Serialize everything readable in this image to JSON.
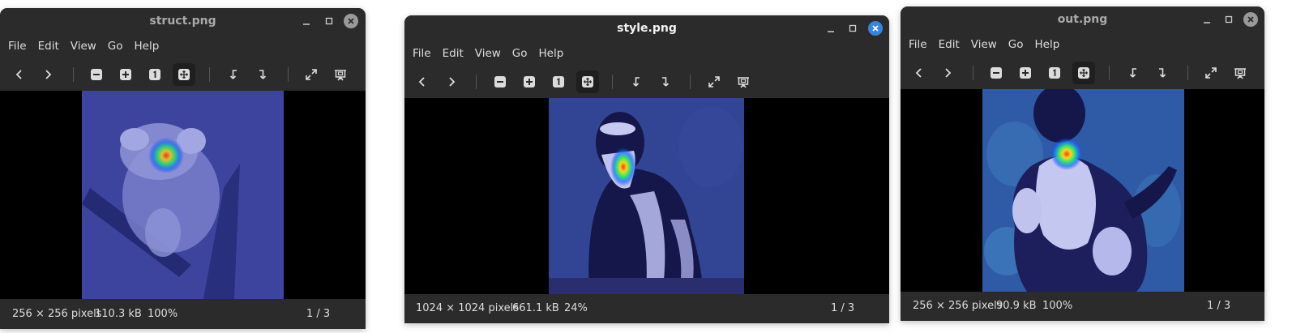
{
  "menu_labels": [
    "File",
    "Edit",
    "View",
    "Go",
    "Help"
  ],
  "toolbar_icons": [
    "previous-icon",
    "next-icon",
    "zoom-out-icon",
    "zoom-in-icon",
    "zoom-normal-icon",
    "best-fit-icon",
    "rotate-left-icon",
    "rotate-right-icon",
    "fullscreen-icon",
    "slideshow-icon"
  ],
  "colors": {
    "window_bg": "#2b2b2b",
    "canvas_bg": "#000000",
    "accent_close": "#3584e4"
  },
  "windows": [
    {
      "title": "struct.png",
      "dimensions": "256 × 256 pixels",
      "size": "110.3 kB",
      "zoom": "100%",
      "position": "1 / 3",
      "active": false
    },
    {
      "title": "style.png",
      "dimensions": "1024 × 1024 pixels",
      "size": "661.1 kB",
      "zoom": "24%",
      "position": "1 / 3",
      "active": true
    },
    {
      "title": "out.png",
      "dimensions": "256 × 256 pixels",
      "size": "90.9 kB",
      "zoom": "100%",
      "position": "1 / 3",
      "active": false
    }
  ]
}
